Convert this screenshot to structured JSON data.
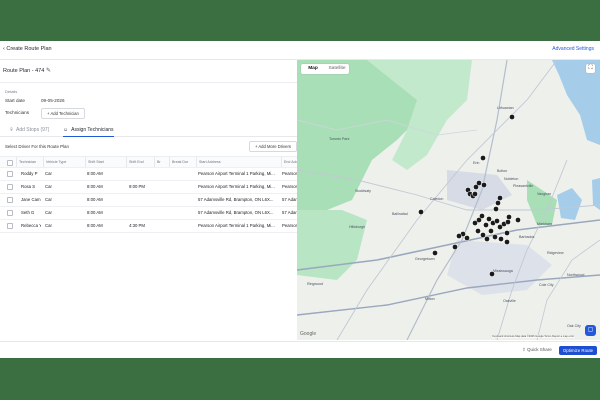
{
  "header": {
    "back_label": "‹ Create Route Plan",
    "advanced_settings": "Advanced Settings"
  },
  "plan": {
    "title": "Route Plan - 474",
    "details_label": "Details",
    "start_date_label": "Start date",
    "start_date_value": "09-05-2026",
    "technicians_label": "Technicians",
    "add_technician": "+ Add Technician"
  },
  "tabs": [
    {
      "label": "Add Stops (97)",
      "icon": "pin-icon",
      "active": false
    },
    {
      "label": "Assign Technicians",
      "icon": "person-icon",
      "active": true
    }
  ],
  "drivers": {
    "select_label": "Select Driver For this Route Plan",
    "add_more": "+ Add More Drivers"
  },
  "table": {
    "columns": [
      "Technician",
      "Vehicle Type",
      "Shift Start",
      "Shift End",
      "Br",
      "Break Dur",
      "Start Address",
      "End Addr"
    ],
    "rows": [
      {
        "technician": "Roddy P",
        "vehicle": "Car",
        "shift_start": "8:00 AM",
        "shift_end": "",
        "start_address": "Pearson Airport Terminal 1 Parking, Mi...",
        "end_address": "Pearson"
      },
      {
        "technician": "Rosa S",
        "vehicle": "Car",
        "shift_start": "8:00 AM",
        "shift_end": "9:00 PM",
        "start_address": "Pearson Airport Terminal 1 Parking, Mi...",
        "end_address": "Pearson"
      },
      {
        "technician": "Jane Cam",
        "vehicle": "Car",
        "shift_start": "8:00 AM",
        "shift_end": "",
        "start_address": "57 Adamsville Rd, Brampton, ON L6X...",
        "end_address": "57 Adan"
      },
      {
        "technician": "Seth G",
        "vehicle": "Car",
        "shift_start": "8:00 AM",
        "shift_end": "",
        "start_address": "57 Adamsville Rd, Brampton, ON L6X...",
        "end_address": "57 Adan"
      },
      {
        "technician": "Rebecca Y",
        "vehicle": "Car",
        "shift_start": "8:00 AM",
        "shift_end": "4:30 PM",
        "start_address": "Pearson Airport Terminal 1 Parking, Mi...",
        "end_address": "Pearson"
      }
    ]
  },
  "map": {
    "toggle_map": "Map",
    "toggle_satellite": "Satellite",
    "google": "Google",
    "attribution": "Keyboard shortcuts   Map data ©2026 Google   Terms   Report a map error",
    "places": [
      "Toronto Park",
      "Lithuanian",
      "Stoddsaty",
      "Hillsburgh",
      "Erin",
      "Bolton",
      "Nobleton",
      "Pleasantville",
      "Caledon",
      "Ballinafad",
      "Georgetown",
      "Mississauga",
      "Markham",
      "Barbados",
      "Ridgeview",
      "Oakville",
      "Milton",
      "Cole City",
      "Northwood",
      "Ringwood",
      "Vaughan",
      "Oak City"
    ]
  },
  "footer": {
    "quick_share": "⇪ Quick Share",
    "optimize": "Optimize Route"
  },
  "colors": {
    "accent": "#2458d8",
    "primary_button": "#1f4fd1",
    "frame_green": "#3b6e41",
    "map_park": "#a9dfb7",
    "map_water": "#a5cdea",
    "marker": "#1a1a1a"
  }
}
